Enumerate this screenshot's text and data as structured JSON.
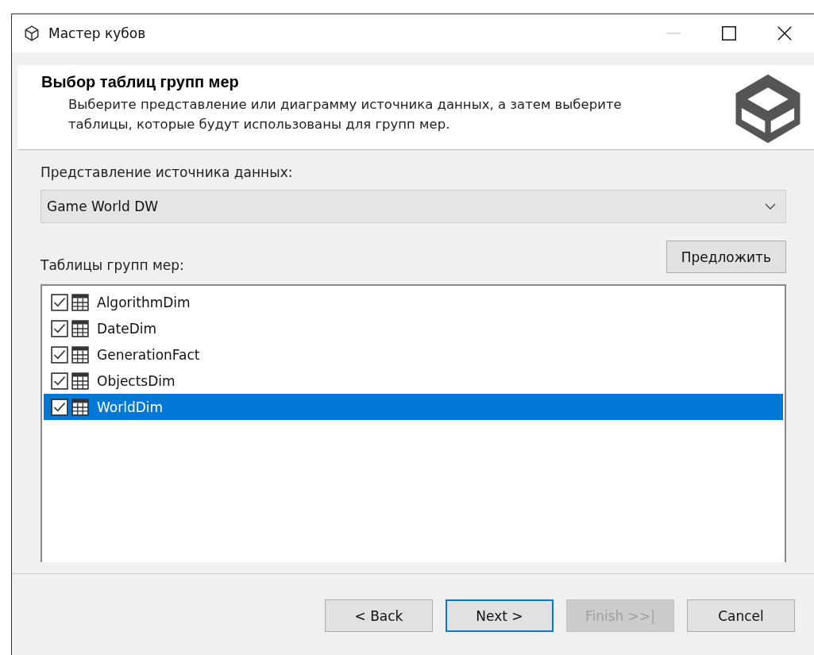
{
  "window": {
    "title": "Мастер кубов"
  },
  "header": {
    "title": "Выбор таблиц групп мер",
    "description": "Выберите представление или диаграмму источника данных, а затем выберите таблицы, которые будут использованы для групп мер."
  },
  "data_source_view": {
    "label": "Представление источника данных:",
    "value": "Game World DW"
  },
  "tables": {
    "label": "Таблицы групп мер:",
    "suggest_button": "Предложить",
    "items": [
      {
        "name": "AlgorithmDim",
        "checked": true,
        "selected": false
      },
      {
        "name": "DateDim",
        "checked": true,
        "selected": false
      },
      {
        "name": "GenerationFact",
        "checked": true,
        "selected": false
      },
      {
        "name": "ObjectsDim",
        "checked": true,
        "selected": false
      },
      {
        "name": "WorldDim",
        "checked": true,
        "selected": true
      }
    ]
  },
  "buttons": [
    {
      "label": "< Back",
      "default": false,
      "disabled": false
    },
    {
      "label": "Next >",
      "default": true,
      "disabled": false
    },
    {
      "label": "Finish >>|",
      "default": false,
      "disabled": true
    },
    {
      "label": "Cancel",
      "default": false,
      "disabled": false
    }
  ]
}
